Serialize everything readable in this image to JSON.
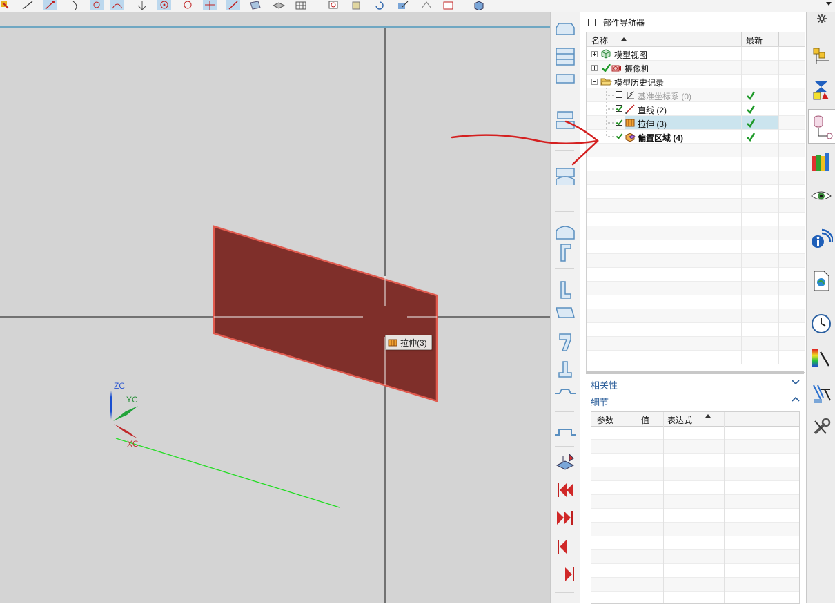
{
  "navigator": {
    "title": "部件导航器",
    "columns": {
      "name": "名称",
      "latest": "最新"
    },
    "tree": [
      {
        "label": "模型视图",
        "expander": "+",
        "icon": "model-view-icon"
      },
      {
        "label": "摄像机",
        "expander": "+",
        "icon": "camera-icon",
        "checked": true
      },
      {
        "label": "模型历史记录",
        "expander": "-",
        "icon": "folder-open-icon"
      },
      {
        "label": "基准坐标系 (0)",
        "icon": "datum-csys-icon",
        "checked": false,
        "latest": true,
        "dimmed": true
      },
      {
        "label": "直线 (2)",
        "icon": "line-icon",
        "checked": true,
        "latest": true
      },
      {
        "label": "拉伸 (3)",
        "icon": "extrude-icon",
        "checked": true,
        "latest": true,
        "selected": true
      },
      {
        "label": "偏置区域 (4)",
        "icon": "offset-region-icon",
        "checked": true,
        "latest": true,
        "bold": true
      }
    ],
    "sections": {
      "dependencies": "相关性",
      "details": "细节"
    },
    "details_columns": {
      "param": "参数",
      "value": "值",
      "expression": "表达式"
    }
  },
  "viewport": {
    "hover_label": "拉伸(3)",
    "axes": {
      "z": "ZC",
      "y": "YC",
      "x": "XC"
    }
  },
  "colors": {
    "viewport_bg": "#d4d4d4",
    "face_fill": "#7f2f2a",
    "face_edge": "#e05a4e",
    "line_green": "#22dd22",
    "annotation_red": "#d42020",
    "accent_blue": "#2b5e9a"
  }
}
